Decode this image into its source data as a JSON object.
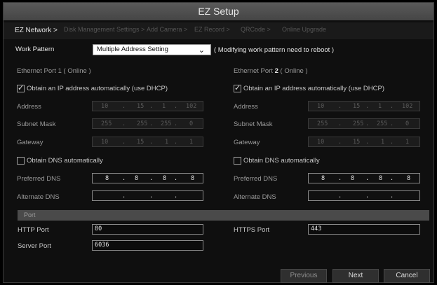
{
  "title": "EZ Setup",
  "wizard_steps": [
    "EZ Network >",
    "Disk Management Settings >",
    "Add Camera >",
    "EZ Record >",
    "QRCode >",
    "Online Upgrade"
  ],
  "work_pattern": {
    "label": "Work Pattern",
    "value": "Multiple Address Setting",
    "note": "( Modifying work pattern need to reboot )"
  },
  "port1": {
    "header": "Ethernet Port 1 ( Online )",
    "dhcp_label": "Obtain an IP address automatically (use DHCP)",
    "dhcp_checked": true,
    "address_label": "Address",
    "address": [
      "10",
      "15",
      "1",
      "102"
    ],
    "mask_label": "Subnet Mask",
    "mask": [
      "255",
      "255",
      "255",
      "0"
    ],
    "gateway_label": "Gateway",
    "gateway": [
      "10",
      "15",
      "1",
      "1"
    ],
    "dns_auto_label": "Obtain DNS automatically",
    "dns_auto_checked": false,
    "pref_dns_label": "Preferred DNS",
    "pref_dns": [
      "8",
      "8",
      "8",
      "8"
    ],
    "alt_dns_label": "Alternate DNS",
    "alt_dns": [
      "",
      "",
      "",
      ""
    ]
  },
  "port2": {
    "header_prefix": "Ethernet Port ",
    "header_num": "2",
    "header_suffix": " ( Online )",
    "dhcp_label": "Obtain an IP address automatically (use DHCP)",
    "dhcp_checked": true,
    "address_label": "Address",
    "address": [
      "10",
      "15",
      "1",
      "102"
    ],
    "mask_label": "Subnet Mask",
    "mask": [
      "255",
      "255",
      "255",
      "0"
    ],
    "gateway_label": "Gateway",
    "gateway": [
      "10",
      "15",
      "1",
      "1"
    ],
    "dns_auto_label": "Obtain DNS automatically",
    "dns_auto_checked": false,
    "pref_dns_label": "Preferred DNS",
    "pref_dns": [
      "8",
      "8",
      "8",
      "8"
    ],
    "alt_dns_label": "Alternate DNS",
    "alt_dns": [
      "",
      "",
      "",
      ""
    ]
  },
  "port_section": {
    "header": "Port",
    "http_label": "HTTP Port",
    "http_value": "80",
    "https_label": "HTTPS Port",
    "https_value": "443",
    "server_label": "Server Port",
    "server_value": "6036"
  },
  "buttons": {
    "previous": "Previous",
    "next": "Next",
    "cancel": "Cancel"
  }
}
